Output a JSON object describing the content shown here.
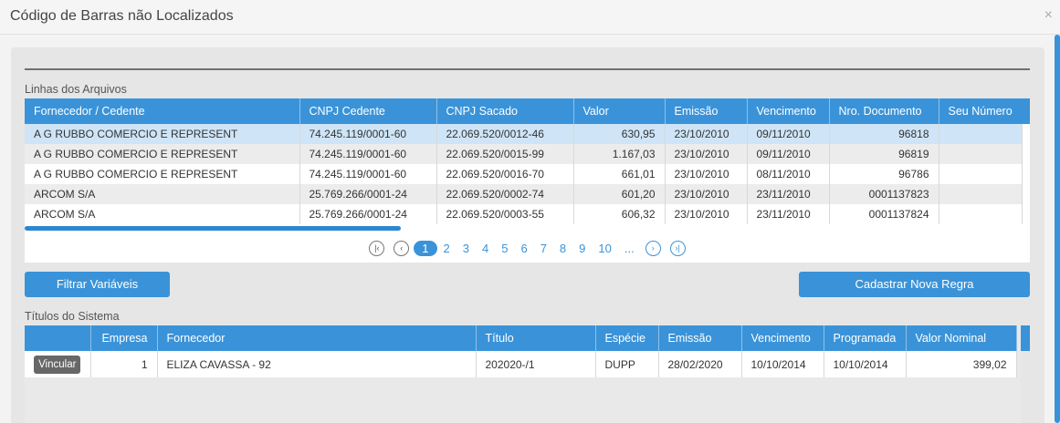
{
  "window": {
    "title": "Código de Barras não Localizados",
    "close_label": "×"
  },
  "linhas": {
    "section_label": "Linhas dos Arquivos",
    "columns": [
      "Fornecedor / Cedente",
      "CNPJ Cedente",
      "CNPJ Sacado",
      "Valor",
      "Emissão",
      "Vencimento",
      "Nro. Documento",
      "Seu Número"
    ],
    "rows": [
      [
        "A G RUBBO COMERCIO E REPRESENT",
        "74.245.119/0001-60",
        "22.069.520/0012-46",
        "630,95",
        "23/10/2010",
        "09/11/2010",
        "96818",
        ""
      ],
      [
        "A G RUBBO COMERCIO E REPRESENT",
        "74.245.119/0001-60",
        "22.069.520/0015-99",
        "1.167,03",
        "23/10/2010",
        "09/11/2010",
        "96819",
        ""
      ],
      [
        "A G RUBBO COMERCIO E REPRESENT",
        "74.245.119/0001-60",
        "22.069.520/0016-70",
        "661,01",
        "23/10/2010",
        "08/11/2010",
        "96786",
        ""
      ],
      [
        "ARCOM S/A",
        "25.769.266/0001-24",
        "22.069.520/0002-74",
        "601,20",
        "23/10/2010",
        "23/11/2010",
        "0001137823",
        ""
      ],
      [
        "ARCOM S/A",
        "25.769.266/0001-24",
        "22.069.520/0003-55",
        "606,32",
        "23/10/2010",
        "23/11/2010",
        "0001137824",
        ""
      ]
    ],
    "selected_row": 0
  },
  "pager": {
    "first_icon": "first-page-icon",
    "prev_icon": "prev-page-icon",
    "pages": [
      "1",
      "2",
      "3",
      "4",
      "5",
      "6",
      "7",
      "8",
      "9",
      "10",
      "..."
    ],
    "active": "1",
    "next_icon": "next-page-icon",
    "last_icon": "last-page-icon"
  },
  "buttons": {
    "filtrar": "Filtrar Variáveis",
    "cadastrar": "Cadastrar Nova Regra"
  },
  "titulos": {
    "section_label": "Títulos do Sistema",
    "columns": [
      "",
      "Empresa",
      "Fornecedor",
      "Título",
      "Espécie",
      "Emissão",
      "Vencimento",
      "Programada",
      "Valor Nominal"
    ],
    "action_label": "Vincular",
    "rows": [
      [
        "1",
        "ELIZA CAVASSA - 92",
        "202020-/1",
        "DUPP",
        "28/02/2020",
        "10/10/2014",
        "10/10/2014",
        "399,02"
      ]
    ]
  },
  "colors": {
    "accent": "#3a93d8",
    "selected_row": "#cfe5f7",
    "button_dark": "#676767"
  }
}
